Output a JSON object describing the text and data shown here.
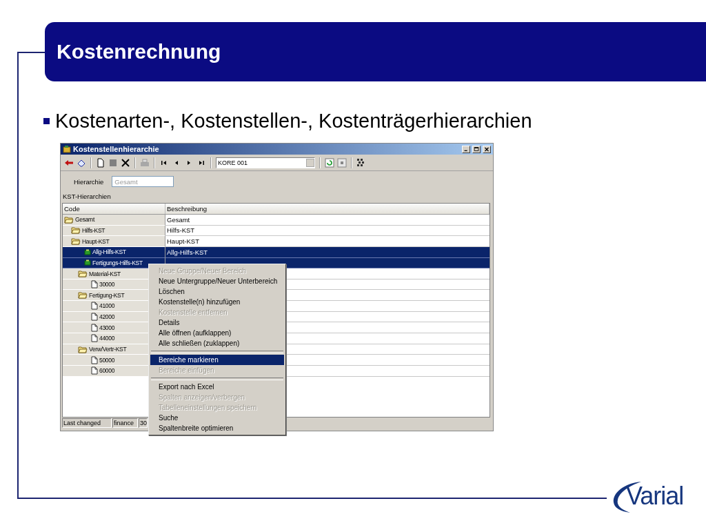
{
  "slide": {
    "title": "Kostenrechnung",
    "bullet": "Kostenarten-, Kostenstellen-, Kostenträgerhierarchien",
    "logo": "Varial"
  },
  "window": {
    "title": "Kostenstellenhierarchie",
    "combo_value": "KORE 001",
    "hierarchy_label": "Hierarchie",
    "hierarchy_value": "Gesamt",
    "section_label": "KST-Hierarchien"
  },
  "table": {
    "columns": [
      "Code",
      "Beschreibung"
    ],
    "rows": [
      {
        "code": "Gesamt",
        "description": "Gesamt",
        "kind": "folder",
        "selected": false,
        "children": [
          {
            "code": "Hilfs-KST",
            "description": "Hilfs-KST",
            "kind": "folder",
            "selected": false
          },
          {
            "code": "Haupt-KST",
            "description": "Haupt-KST",
            "kind": "folder",
            "selected": false,
            "children": [
              {
                "code": "Allg-Hilfs-KST",
                "description": "Allg-Hilfs-KST",
                "kind": "costcenter",
                "selected": true
              },
              {
                "code": "Fertigungs-Hilfs-KST",
                "kind": "costcenter",
                "selected": true
              },
              {
                "code": "Material-KST",
                "kind": "folder",
                "selected": false,
                "children": [
                  {
                    "code": "30000",
                    "kind": "document",
                    "selected": false
                  }
                ]
              },
              {
                "code": "Fertigung-KST",
                "kind": "folder",
                "selected": false,
                "children": [
                  {
                    "code": "41000",
                    "kind": "document",
                    "selected": false
                  },
                  {
                    "code": "42000",
                    "kind": "document",
                    "selected": false
                  },
                  {
                    "code": "43000",
                    "kind": "document",
                    "selected": false
                  },
                  {
                    "code": "44000",
                    "kind": "document",
                    "selected": false
                  }
                ]
              },
              {
                "code": "Verw/Vertr-KST",
                "kind": "folder",
                "selected": false,
                "children": [
                  {
                    "code": "50000",
                    "kind": "document",
                    "selected": false
                  },
                  {
                    "code": "60000",
                    "kind": "document",
                    "selected": false
                  }
                ]
              }
            ]
          }
        ]
      }
    ]
  },
  "status_bar": [
    "Last changed",
    "finance",
    "30"
  ],
  "context_menu": [
    {
      "label": "Neue Gruppe/Neuer Bereich",
      "disabled": true,
      "selected": false,
      "separator_after": false
    },
    {
      "label": "Neue Untergruppe/Neuer Unterbereich",
      "disabled": false,
      "selected": false,
      "separator_after": false
    },
    {
      "label": "Löschen",
      "disabled": false,
      "selected": false,
      "separator_after": false
    },
    {
      "label": "Kostenstelle(n) hinzufügen",
      "disabled": false,
      "selected": false,
      "separator_after": false
    },
    {
      "label": "Kostenstelle entfernen",
      "disabled": true,
      "selected": false,
      "separator_after": false
    },
    {
      "label": "Details",
      "disabled": false,
      "selected": false,
      "separator_after": false
    },
    {
      "label": "Alle öffnen (aufklappen)",
      "disabled": false,
      "selected": false,
      "separator_after": false
    },
    {
      "label": "Alle schließen (zuklappen)",
      "disabled": false,
      "selected": false,
      "separator_after": true
    },
    {
      "label": "Bereiche markieren",
      "disabled": false,
      "selected": true,
      "separator_after": false
    },
    {
      "label": "Bereiche einfügen",
      "disabled": true,
      "selected": false,
      "separator_after": true
    },
    {
      "label": "Export nach Excel",
      "disabled": false,
      "selected": false,
      "separator_after": false
    },
    {
      "label": "Spalten anzeigen/verbergen",
      "disabled": true,
      "selected": false,
      "separator_after": false
    },
    {
      "label": "Tabelleneinstellungen speichern",
      "disabled": true,
      "selected": false,
      "separator_after": false
    },
    {
      "label": "Suche",
      "disabled": false,
      "selected": false,
      "separator_after": false
    },
    {
      "label": "Spaltenbreite optimieren",
      "disabled": false,
      "selected": false,
      "separator_after": false
    }
  ]
}
